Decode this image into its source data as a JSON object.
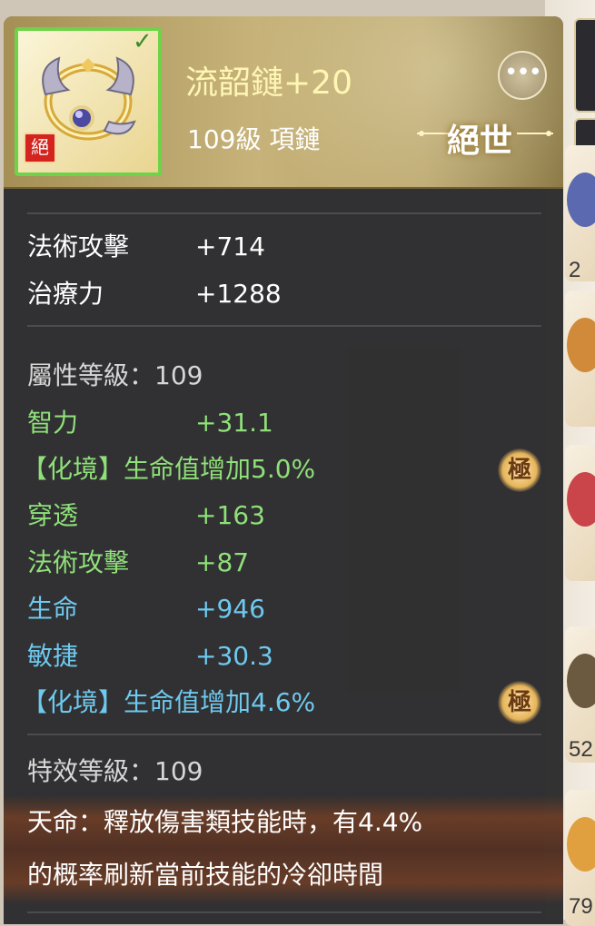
{
  "item": {
    "name": "流韶鏈+20",
    "sub": "109級  項鏈",
    "rarity": "絕世",
    "badge": "絕",
    "more_icon": "ellipsis-icon"
  },
  "base_stats": [
    {
      "label": "法術攻擊",
      "value": "+714"
    },
    {
      "label": "治療力",
      "value": "+1288"
    }
  ],
  "attr_header": "屬性等級：109",
  "attrs": [
    {
      "label": "智力",
      "value": "+31.1",
      "color": "green"
    },
    {
      "label": "【化境】生命值增加5.0%",
      "value": "",
      "color": "green",
      "badge": "極"
    },
    {
      "label": "穿透",
      "value": "+163",
      "color": "green"
    },
    {
      "label": "法術攻擊",
      "value": "+87",
      "color": "green"
    },
    {
      "label": "生命",
      "value": "+946",
      "color": "blue"
    },
    {
      "label": "敏捷",
      "value": "+30.3",
      "color": "blue"
    },
    {
      "label": "【化境】生命值增加4.6%",
      "value": "",
      "color": "blue",
      "badge": "極"
    }
  ],
  "effect_header": "特效等級：109",
  "effect_line1": "天命：釋放傷害類技能時，有4.4%",
  "effect_line2": "的概率刷新當前技能的冷卻時間",
  "side_numbers": [
    "2",
    "52",
    "79"
  ],
  "colors": {
    "green": "#8fe07a",
    "blue": "#6ec9ee",
    "frame": "#6fd34a",
    "name": "#fff6b3"
  }
}
